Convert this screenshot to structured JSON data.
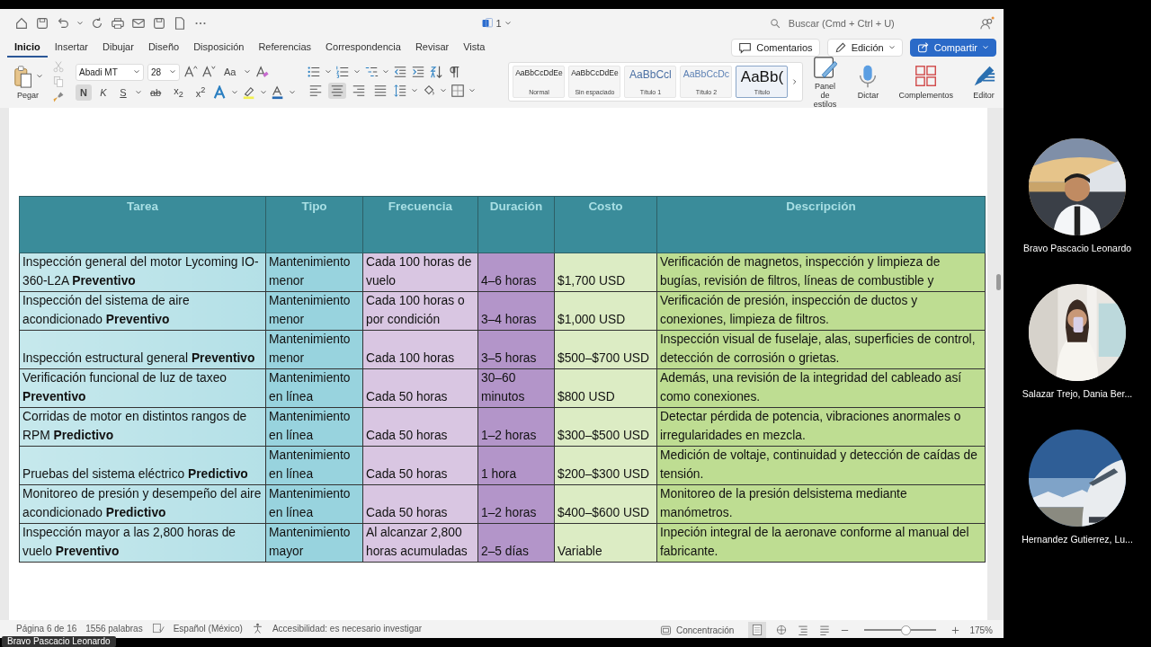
{
  "toolbar": {
    "doc_count": "1",
    "search": {
      "placeholder": "Buscar (Cmd + Ctrl + U)"
    }
  },
  "tabs": [
    {
      "label": "Inicio",
      "selected": true
    },
    {
      "label": "Insertar",
      "selected": false
    },
    {
      "label": "Dibujar",
      "selected": false
    },
    {
      "label": "Diseño",
      "selected": false
    },
    {
      "label": "Disposición",
      "selected": false
    },
    {
      "label": "Referencias",
      "selected": false
    },
    {
      "label": "Correspondencia",
      "selected": false
    },
    {
      "label": "Revisar",
      "selected": false
    },
    {
      "label": "Vista",
      "selected": false
    }
  ],
  "actions": {
    "comments": "Comentarios",
    "editing": "Edición",
    "share": "Compartir"
  },
  "ribbon": {
    "paste": "Pegar",
    "font": "Abadi MT",
    "size": "28",
    "change_case": "Aa",
    "format_buttons": [
      {
        "label": "N",
        "selected": true
      },
      {
        "label": "K",
        "selected": false
      },
      {
        "label": "S",
        "selected": false
      },
      {
        "label": "ab",
        "selected": false
      },
      {
        "label": "x$_{2}$",
        "selected": false
      },
      {
        "label": "x$^{2}$",
        "selected": false
      }
    ],
    "alignments": [
      {
        "selected": false
      },
      {
        "selected": true
      },
      {
        "selected": false
      },
      {
        "selected": false
      }
    ],
    "styles": [
      {
        "sample": "AaBbCcDdEe",
        "name": "Normal",
        "kind": "normal",
        "selected": false
      },
      {
        "sample": "AaBbCcDdEe",
        "name": "Sin espaciado",
        "kind": "normal",
        "selected": false
      },
      {
        "sample": "AaBbCcl",
        "name": "Título 1",
        "kind": "heading1",
        "selected": false
      },
      {
        "sample": "AaBbCcDc",
        "name": "Título 2",
        "kind": "heading2",
        "selected": false
      },
      {
        "sample": "AaBb(",
        "name": "Título",
        "kind": "title",
        "selected": true
      }
    ],
    "styles_pane": "Panel de estilos",
    "dictate": "Dictar",
    "addins": "Complementos",
    "editor": "Editor"
  },
  "table": {
    "columns": [
      "Tarea",
      "Tipo",
      "Frecuencia",
      "Duración",
      "Costo",
      "Descripción"
    ],
    "rows": [
      [
        "Inspección general del motor Lycoming IO-360-L2A **Preventivo**",
        "Mantenimiento menor",
        "Cada 100 horas de vuelo",
        "4–6 horas",
        "$1,700 USD",
        "Verificación de magnetos, inspección y limpieza de bugías,      revisión de filtros, líneas de combustible y"
      ],
      [
        "Inspección del sistema de aire acondicionado **Preventivo**",
        "Mantenimiento menor",
        "Cada 100 horas o por condición",
        "3–4 horas",
        "$1,000 USD",
        "Verificación de presión, inspección de ductos y conexiones, limpieza de filtros."
      ],
      [
        "Inspección estructural general **Preventivo**",
        "Mantenimiento menor",
        "Cada 100 horas",
        "3–5 horas",
        "$500–$700 USD",
        "Inspección visual de fuselaje, alas, superficies de control, detección de corrosión o grietas."
      ],
      [
        "Verificación funcional de luz de taxeo **Preventivo**",
        "Mantenimiento en línea",
        "Cada 50 horas",
        "30–60 minutos",
        "$800 USD",
        "Además, una revisión de la integridad del cableado así como conexiones."
      ],
      [
        "Corridas de motor en distintos rangos de RPM **Predictivo**",
        "Mantenimiento en línea",
        "Cada 50 horas",
        "1–2 horas",
        "$300–$500 USD",
        "Detectar pérdida de potencia, vibraciones anormales o irregularidades en mezcla."
      ],
      [
        "Pruebas del sistema eléctrico **Predictivo**",
        "Mantenimiento en línea",
        "Cada 50 horas",
        "1 hora",
        "$200–$300 USD",
        "Medición de voltaje, continuidad y detección de caídas de tensión."
      ],
      [
        "Monitoreo de presión y desempeño del aire acondicionado **Predictivo**",
        "Mantenimiento en línea",
        "Cada 50 horas",
        "1–2 horas",
        "$400–$600 USD",
        "Monitoreo de la presión delsistema mediante manómetros."
      ],
      [
        "Inspección mayor a las 2,800 horas de vuelo **Preventivo**",
        "Mantenimiento mayor",
        "Al alcanzar 2,800 horas acumuladas",
        "2–5 días",
        "Variable",
        "Inpeción integral de la aeronave conforme al manual del fabricante."
      ]
    ]
  },
  "status_bar": {
    "page": "Página 6 de 16",
    "words": "1556 palabras",
    "language": "Español (México)",
    "accessibility": "Accesibilidad: es necesario investigar",
    "focus": "Concentración",
    "zoom_slider": {
      "level": 0.57
    },
    "zoom": "175%"
  },
  "participants": [
    {
      "name": "Bravo Pascacio Leonardo",
      "kind": "pilot"
    },
    {
      "name": "Salazar Trejo, Dania Ber...",
      "kind": "room"
    },
    {
      "name": "Hernandez Gutierrez, Lu...",
      "kind": "aircraft"
    }
  ],
  "speaker": "Bravo Pascacio Leonardo"
}
